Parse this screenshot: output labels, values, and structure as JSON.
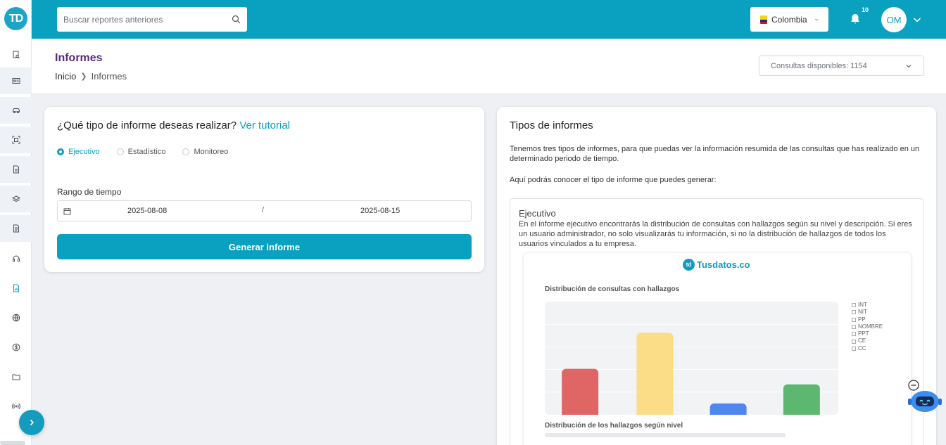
{
  "logo_text": "TD",
  "search": {
    "placeholder": "Buscar reportes anteriores"
  },
  "topbar": {
    "country": "Colombia",
    "notifications_count": "10",
    "avatar_initials": "OM"
  },
  "header": {
    "title": "Informes",
    "breadcrumb": [
      "Inicio",
      "Informes"
    ],
    "consultas": "Consultas disponibles: 1154"
  },
  "form": {
    "question": "¿Qué tipo de informe deseas realizar?",
    "tutorial_link": "Ver tutorial",
    "options": [
      "Ejecutivo",
      "Estadístico",
      "Monitoreo"
    ],
    "selected": "Ejecutivo",
    "range_label": "Rango de tiempo",
    "date_start": "2025-08-08",
    "date_separator": "/",
    "date_end": "2025-08-15",
    "button": "Generar informe"
  },
  "tipos": {
    "title": "Tipos de informes",
    "desc": "Tenemos tres tipos de informes, para que puedas ver la información resumida de las consultas que has realizado en un determinado periodo de tiempo.",
    "desc2": "Aquí podrás conocer el tipo de informe que puedes generar:",
    "ejecutivo_title": "Ejecutivo",
    "ejecutivo_desc": "En el informe ejecutivo encontrarás la distribución de consultas con hallazgos según su nivel y descripción. Si eres un usuario administrador, no solo visualizarás tu información, si no la distribución de hallazgos de todos los usuarios vinculados a tu empresa.",
    "preview_brand": "Tusdatos.co",
    "preview_mark": "td",
    "chart1_title": "Distribución de consultas con hallazgos",
    "chart2_title": "Distribución de los hallazgos según nivel"
  },
  "chart_data": {
    "type": "bar",
    "categories": [
      "",
      "",
      "",
      ""
    ],
    "values": [
      65,
      116,
      16,
      43
    ],
    "colors": [
      "#e06666",
      "#fbdd88",
      "#4f86f0",
      "#5cb870"
    ],
    "ylim": [
      0,
      160
    ],
    "legend": [
      "INT",
      "NIT",
      "PP",
      "NOMBRE",
      "PPT",
      "CE",
      "CC"
    ],
    "legend_position": "right",
    "grid": true
  },
  "colors": {
    "primary": "#0aa0c0",
    "title": "#5a2a7a"
  }
}
